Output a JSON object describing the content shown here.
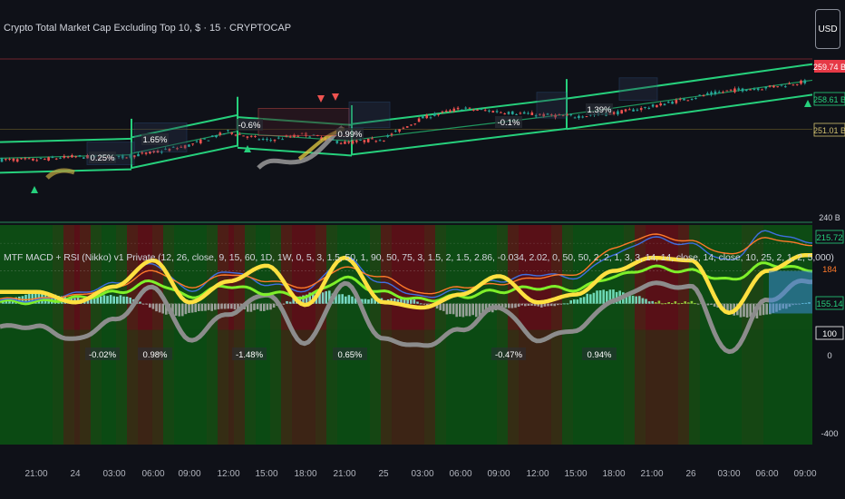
{
  "header": {
    "title": "Crypto Total Market Cap Excluding Top 10, $ · 15 · CRYPTOCAP",
    "currency_button": "USD"
  },
  "indicator": {
    "title": "MTF MACD + RSI (Nikko) v1 Private (12, 26, close, 9, 15, 60, 1D, 1W, 0, 5, 3, 1.5, 50, 1, 90, 50, 75, 3, 1.5, 2, 1.5, 2.86, -0.034, 2.02, 0, 50, 50, 2, 2, 1, 3, 3, 14, 14, close, 14, close, 10, 25, 2, 1, 2, 5,000)"
  },
  "colors": {
    "background": "#0f1118",
    "channel": "#26d07c",
    "up_candle": "#26a69a",
    "down_candle": "#ef5350",
    "macd_line": "#3f6fe0",
    "signal_line": "#ff7a2a",
    "rsi_line": "#ffe040",
    "gray_line": "#8c8c8c",
    "green_line": "#7ef02a"
  },
  "chart_data": [
    {
      "type": "line",
      "name": "price_pane",
      "x": [
        "21:00",
        "24",
        "03:00",
        "06:00",
        "09:00",
        "12:00",
        "15:00",
        "18:00",
        "21:00",
        "25",
        "03:00",
        "06:00",
        "09:00",
        "12:00",
        "15:00",
        "18:00",
        "21:00",
        "26",
        "03:00",
        "06:00",
        "09:00"
      ],
      "y_ticks": [
        "259.74 B",
        "258.61 B",
        "251.01 B",
        "240 B"
      ],
      "series": [
        {
          "values": [
            247.2,
            247.6,
            247.4,
            248.1,
            249.0,
            250.7,
            249.6,
            250.4,
            249.3,
            249.8,
            252.4,
            253.6,
            253.2,
            252.8,
            252.6,
            253.0,
            253.8,
            254.9,
            255.8,
            256.2,
            256.9
          ]
        }
      ],
      "segment_labels": [
        {
          "x": "03:00",
          "text": "0.25%"
        },
        {
          "x": "06:00",
          "text": "1.65%"
        },
        {
          "x": "15:00",
          "text": "-0.6%"
        },
        {
          "x": "21:00",
          "text": "0.99%"
        },
        {
          "x": "09:00",
          "text": "-0.1%"
        },
        {
          "x": "15:00",
          "text": "1.39%"
        }
      ]
    },
    {
      "type": "line",
      "name": "indicator_pane",
      "y_ticks": [
        "215.72",
        "184",
        "155.14",
        "100",
        "0",
        "-400"
      ],
      "series": [
        {
          "values": [
            10,
            30,
            60,
            120,
            40,
            100,
            60,
            40,
            140,
            60,
            20,
            40,
            70,
            90,
            80,
            150,
            200,
            180,
            130,
            220,
            190
          ]
        },
        {
          "values": [
            15,
            25,
            50,
            100,
            50,
            90,
            70,
            50,
            110,
            80,
            30,
            50,
            60,
            80,
            90,
            170,
            210,
            190,
            150,
            200,
            180
          ]
        },
        {
          "values": [
            20,
            -20,
            40,
            140,
            -20,
            60,
            120,
            -30,
            150,
            -20,
            -40,
            10,
            80,
            -20,
            10,
            100,
            150,
            140,
            -60,
            100,
            160
          ]
        }
      ],
      "segment_labels": [
        {
          "x": "03:00",
          "text": "-0.02%"
        },
        {
          "x": "06:00",
          "text": "0.98%"
        },
        {
          "x": "15:00",
          "text": "-1.48%"
        },
        {
          "x": "21:00",
          "text": "0.65%"
        },
        {
          "x": "09:00",
          "text": "-0.47%"
        },
        {
          "x": "15:00",
          "text": "0.94%"
        }
      ]
    }
  ]
}
